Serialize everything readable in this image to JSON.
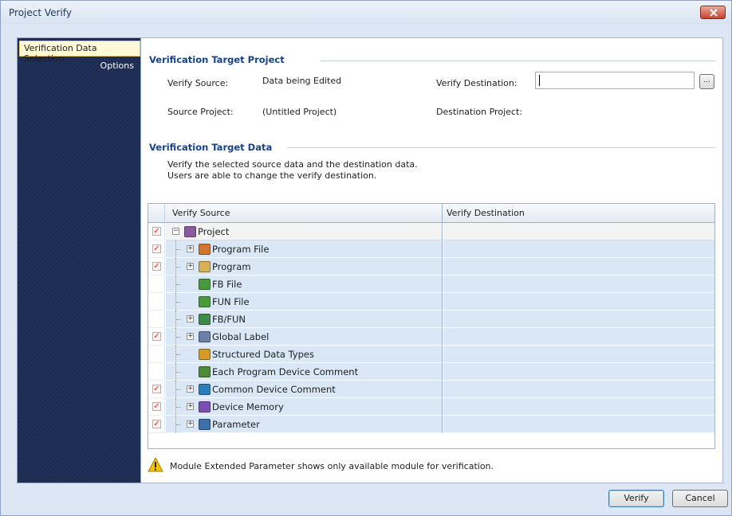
{
  "window": {
    "title": "Project Verify"
  },
  "nav": {
    "items": [
      {
        "label": "Verification Data Selection",
        "selected": true
      },
      {
        "label": "Options",
        "selected": false
      }
    ]
  },
  "target_project": {
    "heading": "Verification Target Project",
    "verify_source_label": "Verify Source:",
    "verify_source_value": "Data being Edited",
    "source_project_label": "Source Project:",
    "source_project_value": "(Untitled Project)",
    "verify_destination_label": "Verify Destination:",
    "verify_destination_value": "",
    "browse_label": "...",
    "destination_project_label": "Destination Project:"
  },
  "target_data": {
    "heading": "Verification Target Data",
    "description_line1": "Verify the selected source data and the destination data.",
    "description_line2": "Users are able to change the verify destination."
  },
  "grid": {
    "columns": [
      "Verify Source",
      "Verify Destination"
    ],
    "rows": [
      {
        "label": "Project",
        "checked": true,
        "expander": "minus",
        "icon": "project-icon"
      },
      {
        "label": "Program File",
        "checked": true,
        "expander": "plus",
        "icon": "program-file-icon"
      },
      {
        "label": "Program",
        "checked": true,
        "expander": "plus",
        "icon": "program-icon"
      },
      {
        "label": "FB File",
        "checked": false,
        "expander": "none",
        "icon": "fb-file-icon"
      },
      {
        "label": "FUN File",
        "checked": false,
        "expander": "none",
        "icon": "fun-file-icon"
      },
      {
        "label": "FB/FUN",
        "checked": false,
        "expander": "plus",
        "icon": "fb-fun-icon"
      },
      {
        "label": "Global Label",
        "checked": true,
        "expander": "plus",
        "icon": "global-label-icon"
      },
      {
        "label": "Structured Data Types",
        "checked": false,
        "expander": "none",
        "icon": "structured-data-icon"
      },
      {
        "label": "Each Program Device Comment",
        "checked": false,
        "expander": "none",
        "icon": "device-comment-icon"
      },
      {
        "label": "Common Device Comment",
        "checked": true,
        "expander": "plus",
        "icon": "common-comment-icon"
      },
      {
        "label": "Device Memory",
        "checked": true,
        "expander": "plus",
        "icon": "device-memory-icon"
      },
      {
        "label": "Parameter",
        "checked": true,
        "expander": "plus",
        "icon": "parameter-icon"
      }
    ]
  },
  "notice": {
    "text": "Module Extended Parameter shows only available module for verification."
  },
  "buttons": {
    "verify": "Verify",
    "cancel": "Cancel"
  }
}
